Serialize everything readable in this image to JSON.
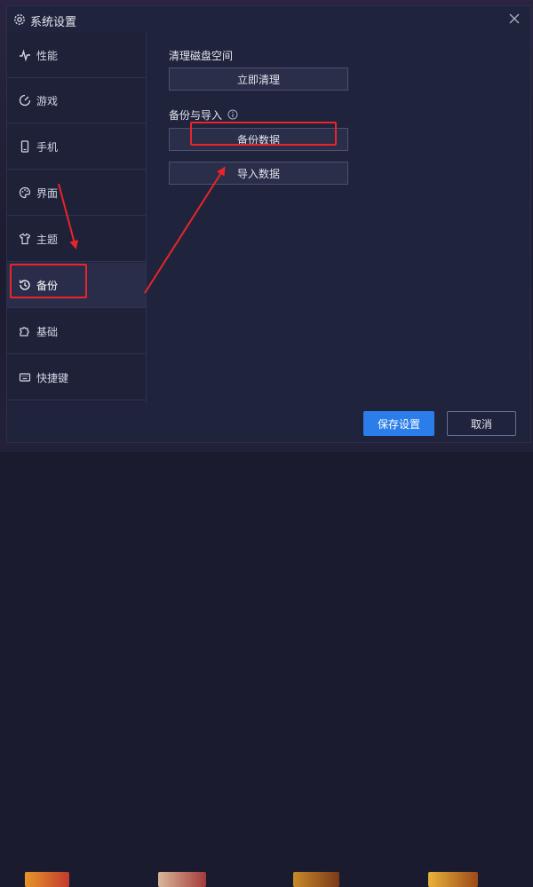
{
  "window": {
    "title": "系统设置"
  },
  "sidebar": {
    "items": [
      {
        "label": "性能",
        "icon": "pulse-icon"
      },
      {
        "label": "游戏",
        "icon": "gamepad-icon"
      },
      {
        "label": "手机",
        "icon": "phone-icon"
      },
      {
        "label": "界面",
        "icon": "palette-icon"
      },
      {
        "label": "主题",
        "icon": "shirt-icon"
      },
      {
        "label": "备份",
        "icon": "history-icon",
        "active": true
      },
      {
        "label": "基础",
        "icon": "puzzle-icon"
      },
      {
        "label": "快捷键",
        "icon": "keyboard-icon"
      }
    ]
  },
  "content": {
    "disk_section_label": "清理磁盘空间",
    "clean_button": "立即清理",
    "backup_section_label": "备份与导入",
    "backup_button": "备份数据",
    "import_button": "导入数据"
  },
  "footer": {
    "save_button": "保存设置",
    "cancel_button": "取消"
  },
  "colors": {
    "accent": "#2b7de9",
    "annotation": "#e8252a",
    "panel": "#20233c"
  }
}
